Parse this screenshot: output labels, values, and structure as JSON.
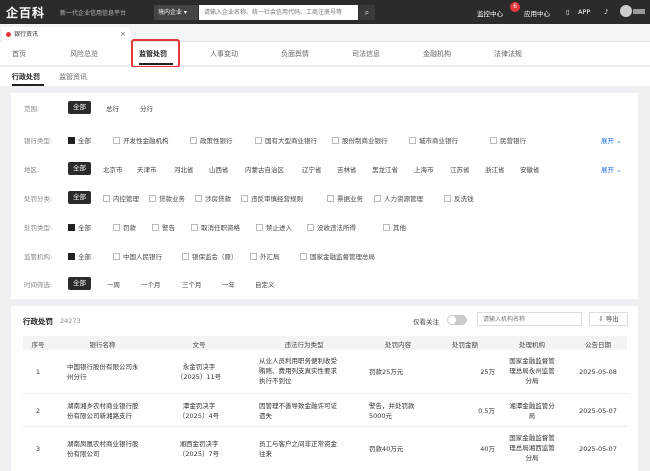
{
  "topbar": {
    "logo": "企百科",
    "slogan": "新一代企业信用信息平台",
    "scope": "境内企业 ▾",
    "search_placeholder": "请输入企业名称、统一社会信用代码、工商注册号等",
    "monitor": "监控中心",
    "monitor_badge": "6",
    "app_center": "应用中心",
    "app": "APP"
  },
  "doc_tab": {
    "label": "银行资讯",
    "close": "×"
  },
  "nav": {
    "items": [
      "首页",
      "风险总览",
      "监管处罚",
      "人事变动",
      "负面舆情",
      "司法信息",
      "金融机构",
      "法律法规"
    ],
    "active": "监管处罚"
  },
  "subnav": {
    "items": [
      "行政处罚",
      "监管资讯"
    ],
    "active": "行政处罚"
  },
  "filters": {
    "scope": {
      "label": "范围:",
      "options": [
        "全部",
        "总行",
        "分行"
      ]
    },
    "bank_type": {
      "label": "银行类型:",
      "options": [
        "全部",
        "开发性金融机构",
        "政策性银行",
        "国有大型商业银行",
        "股份制商业银行",
        "城市商业银行",
        "民营银行"
      ]
    },
    "region": {
      "label": "地区:",
      "options": [
        "全部",
        "北京市",
        "天津市",
        "河北省",
        "山西省",
        "内蒙古自治区",
        "辽宁省",
        "吉林省",
        "黑龙江省",
        "上海市",
        "江苏省",
        "浙江省",
        "安徽省"
      ]
    },
    "penalty_cat": {
      "label": "处罚分类:",
      "options": [
        "全部",
        "内控管理",
        "贷款业务",
        "涉房贷款",
        "违反审慎经营规则",
        "票据业务",
        "人力资源管理",
        "反洗钱"
      ]
    },
    "penalty_type": {
      "label": "处罚类型:",
      "options": [
        "全部",
        "罚款",
        "警告",
        "取消任职资格",
        "禁止进入",
        "没收违法所得",
        "其他"
      ]
    },
    "regulator": {
      "label": "监管机构:",
      "options": [
        "全部",
        "中国人民银行",
        "银保监会（原）",
        "外汇局",
        "国家金融监督管理总局"
      ]
    },
    "time": {
      "label": "时间筛选:",
      "options": [
        "全部",
        "一周",
        "一个月",
        "三个月",
        "一年",
        "自定义"
      ]
    },
    "expand": "展开"
  },
  "results": {
    "title": "行政处罚",
    "count": "24273",
    "only_label": "仅看关注",
    "org_placeholder": "请输入机构名称",
    "export": "导出",
    "columns": [
      "序号",
      "银行名称",
      "文号",
      "违法行为类型",
      "处罚内容",
      "处罚金额",
      "处理机构",
      "公告日期"
    ],
    "rows": [
      {
        "no": "1",
        "bank": [
          "中国银行股份有限公司永",
          "州分行"
        ],
        "doc": [
          "永金罚决字",
          "〔2025〕11号"
        ],
        "violation": [
          "从业人员利用职务便利收受",
          "贿赂、费用列支真实性要求",
          "执行不到位"
        ],
        "content": [
          "罚款25万元"
        ],
        "amount": "25万",
        "agency": [
          "国家金融监督管",
          "理总局永州监管",
          "分局"
        ],
        "date": "2025-05-08"
      },
      {
        "no": "2",
        "bank": [
          "湖南湘乡农村商业银行股",
          "份有限公司新湘路支行"
        ],
        "doc": [
          "潭金罚决字",
          "〔2025〕4号"
        ],
        "violation": [
          "因管理不善导致金融许可证",
          "遗失"
        ],
        "content": [
          "警告，并处罚款",
          "5000元"
        ],
        "amount": "0.5万",
        "agency": [
          "湘潭金融监管分",
          "局"
        ],
        "date": "2025-05-07"
      },
      {
        "no": "3",
        "bank": [
          "湖南凤凰农村商业银行股",
          "份有限公司"
        ],
        "doc": [
          "湘西金罚决字",
          "〔2025〕7号"
        ],
        "violation": [
          "员工与客户之间非正常资金",
          "往来"
        ],
        "content": [
          "罚款40万元"
        ],
        "amount": "40万",
        "agency": [
          "国家金融监督管",
          "理总局湘西监管",
          "分局"
        ],
        "date": "2025-05-07"
      }
    ]
  },
  "colors": {
    "accent": "#1f6fe5",
    "highlight": "#e5383b",
    "dark": "#2b2b2b"
  }
}
